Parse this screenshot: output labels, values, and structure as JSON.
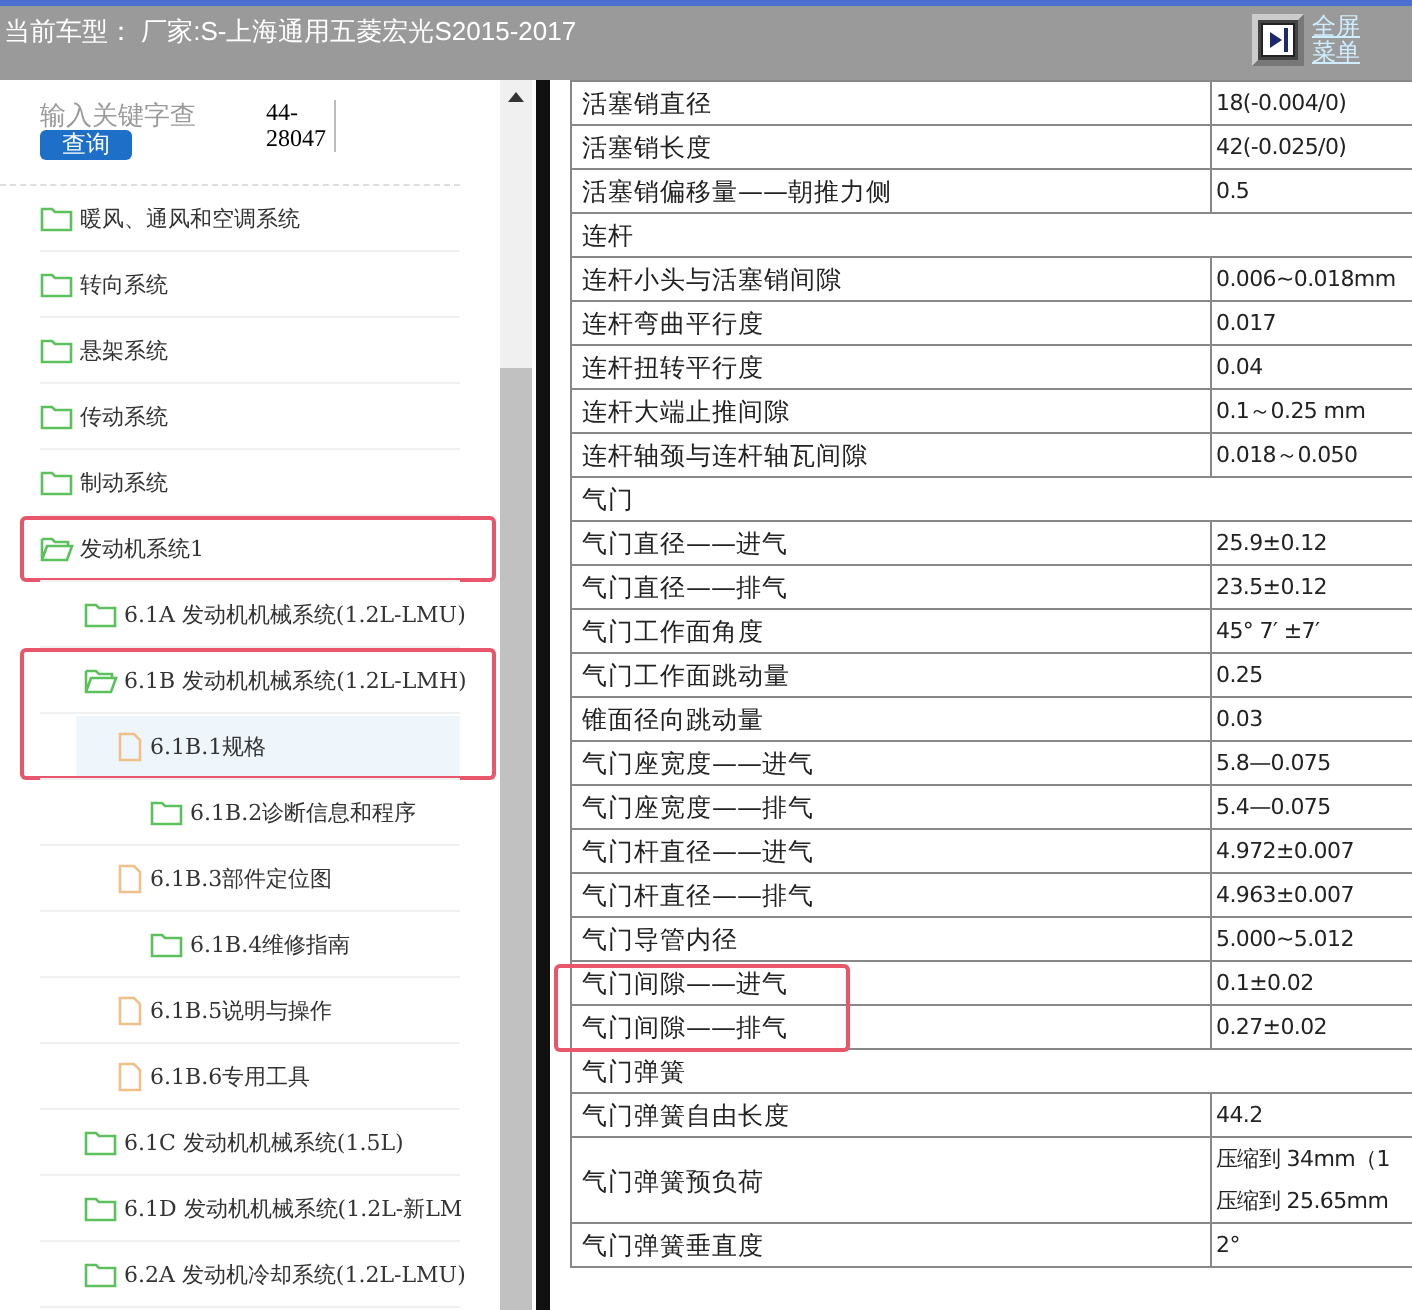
{
  "header": {
    "title": "当前车型： 厂家:S-上海通用五菱宏光S2015-2017",
    "links": [
      "全屏",
      "菜单"
    ]
  },
  "search": {
    "placeholder": "输入关键字查",
    "button": "查询",
    "code": "44-28047"
  },
  "tree": [
    {
      "label": "暖风、通风和空调系统",
      "kind": "folder",
      "expanded": false,
      "circled": false,
      "selected": false
    },
    {
      "label": "转向系统",
      "kind": "folder",
      "expanded": false,
      "circled": false,
      "selected": false
    },
    {
      "label": "悬架系统",
      "kind": "folder",
      "expanded": false,
      "circled": false,
      "selected": false
    },
    {
      "label": "传动系统",
      "kind": "folder",
      "expanded": false,
      "circled": false,
      "selected": false
    },
    {
      "label": "制动系统",
      "kind": "folder",
      "expanded": false,
      "circled": false,
      "selected": false
    },
    {
      "label": "发动机系统1",
      "kind": "folder",
      "expanded": true,
      "circled": true,
      "selected": false,
      "children": [
        {
          "label": "6.1A 发动机机械系统(1.2L-LMU)",
          "kind": "folder",
          "expanded": false,
          "circled": false,
          "selected": false
        },
        {
          "label": "6.1B 发动机机械系统(1.2L-LMH)",
          "kind": "folder",
          "expanded": true,
          "circled": true,
          "selected": false,
          "children": [
            {
              "label": "6.1B.1规格",
              "kind": "file",
              "circled": true,
              "selected": true
            },
            {
              "label": "6.1B.2诊断信息和程序",
              "kind": "folder",
              "expanded": false,
              "circled": false,
              "selected": false
            },
            {
              "label": "6.1B.3部件定位图",
              "kind": "file",
              "circled": false,
              "selected": false
            },
            {
              "label": "6.1B.4维修指南",
              "kind": "folder",
              "expanded": false,
              "circled": false,
              "selected": false
            },
            {
              "label": "6.1B.5说明与操作",
              "kind": "file",
              "circled": false,
              "selected": false
            },
            {
              "label": "6.1B.6专用工具",
              "kind": "file",
              "circled": false,
              "selected": false
            }
          ]
        },
        {
          "label": "6.1C 发动机机械系统(1.5L)",
          "kind": "folder",
          "expanded": false,
          "circled": false,
          "selected": false
        },
        {
          "label": "6.1D 发动机机械系统(1.2L-新LM",
          "kind": "folder",
          "expanded": false,
          "circled": false,
          "selected": false
        },
        {
          "label": "6.2A 发动机冷却系统(1.2L-LMU)",
          "kind": "folder",
          "expanded": false,
          "circled": false,
          "selected": false
        }
      ]
    }
  ],
  "table": {
    "rows": [
      {
        "kind": "spec",
        "label": "活塞销直径",
        "values": [
          "18(-0.004/0)"
        ],
        "circled": false
      },
      {
        "kind": "spec",
        "label": "活塞销长度",
        "values": [
          "42(-0.025/0)"
        ],
        "circled": false
      },
      {
        "kind": "spec",
        "label": "活塞销偏移量——朝推力侧",
        "values": [
          "0.5"
        ],
        "circled": false
      },
      {
        "kind": "section",
        "label": "连杆"
      },
      {
        "kind": "spec",
        "label": "连杆小头与活塞销间隙",
        "values": [
          "0.006~0.018mm"
        ],
        "circled": false
      },
      {
        "kind": "spec",
        "label": "连杆弯曲平行度",
        "values": [
          "0.017"
        ],
        "circled": false
      },
      {
        "kind": "spec",
        "label": "连杆扭转平行度",
        "values": [
          "0.04"
        ],
        "circled": false
      },
      {
        "kind": "spec",
        "label": "连杆大端止推间隙",
        "values": [
          "0.1～0.25 mm"
        ],
        "circled": false
      },
      {
        "kind": "spec",
        "label": "连杆轴颈与连杆轴瓦间隙",
        "values": [
          "0.018～0.050"
        ],
        "circled": false
      },
      {
        "kind": "section",
        "label": "气门"
      },
      {
        "kind": "spec",
        "label": "气门直径——进气",
        "values": [
          "25.9±0.12"
        ],
        "circled": false
      },
      {
        "kind": "spec",
        "label": "气门直径——排气",
        "values": [
          "23.5±0.12"
        ],
        "circled": false
      },
      {
        "kind": "spec",
        "label": "气门工作面角度",
        "values": [
          "45° 7′ ±7′"
        ],
        "circled": false
      },
      {
        "kind": "spec",
        "label": "气门工作面跳动量",
        "values": [
          "0.25"
        ],
        "circled": false
      },
      {
        "kind": "spec",
        "label": "锥面径向跳动量",
        "values": [
          "0.03"
        ],
        "circled": false
      },
      {
        "kind": "spec",
        "label": "气门座宽度——进气",
        "values": [
          "5.8—0.075"
        ],
        "circled": false
      },
      {
        "kind": "spec",
        "label": "气门座宽度——排气",
        "values": [
          "5.4—0.075"
        ],
        "circled": false
      },
      {
        "kind": "spec",
        "label": "气门杆直径——进气",
        "values": [
          "4.972±0.007"
        ],
        "circled": false
      },
      {
        "kind": "spec",
        "label": "气门杆直径——排气",
        "values": [
          "4.963±0.007"
        ],
        "circled": false
      },
      {
        "kind": "spec",
        "label": "气门导管内径",
        "values": [
          "5.000~5.012"
        ],
        "circled": false
      },
      {
        "kind": "spec",
        "label": "气门间隙——进气",
        "values": [
          "0.1±0.02"
        ],
        "circled": true
      },
      {
        "kind": "spec",
        "label": "气门间隙——排气",
        "values": [
          "0.27±0.02"
        ],
        "circled": true
      },
      {
        "kind": "section",
        "label": "气门弹簧"
      },
      {
        "kind": "spec",
        "label": "气门弹簧自由长度",
        "values": [
          "44.2"
        ],
        "circled": false
      },
      {
        "kind": "spec",
        "label": "气门弹簧预负荷",
        "values": [
          "压缩到 34mm（1",
          "压缩到 25.65mm"
        ],
        "circled": false
      },
      {
        "kind": "spec",
        "label": "气门弹簧垂直度",
        "values": [
          "2°"
        ],
        "circled": false
      }
    ]
  }
}
